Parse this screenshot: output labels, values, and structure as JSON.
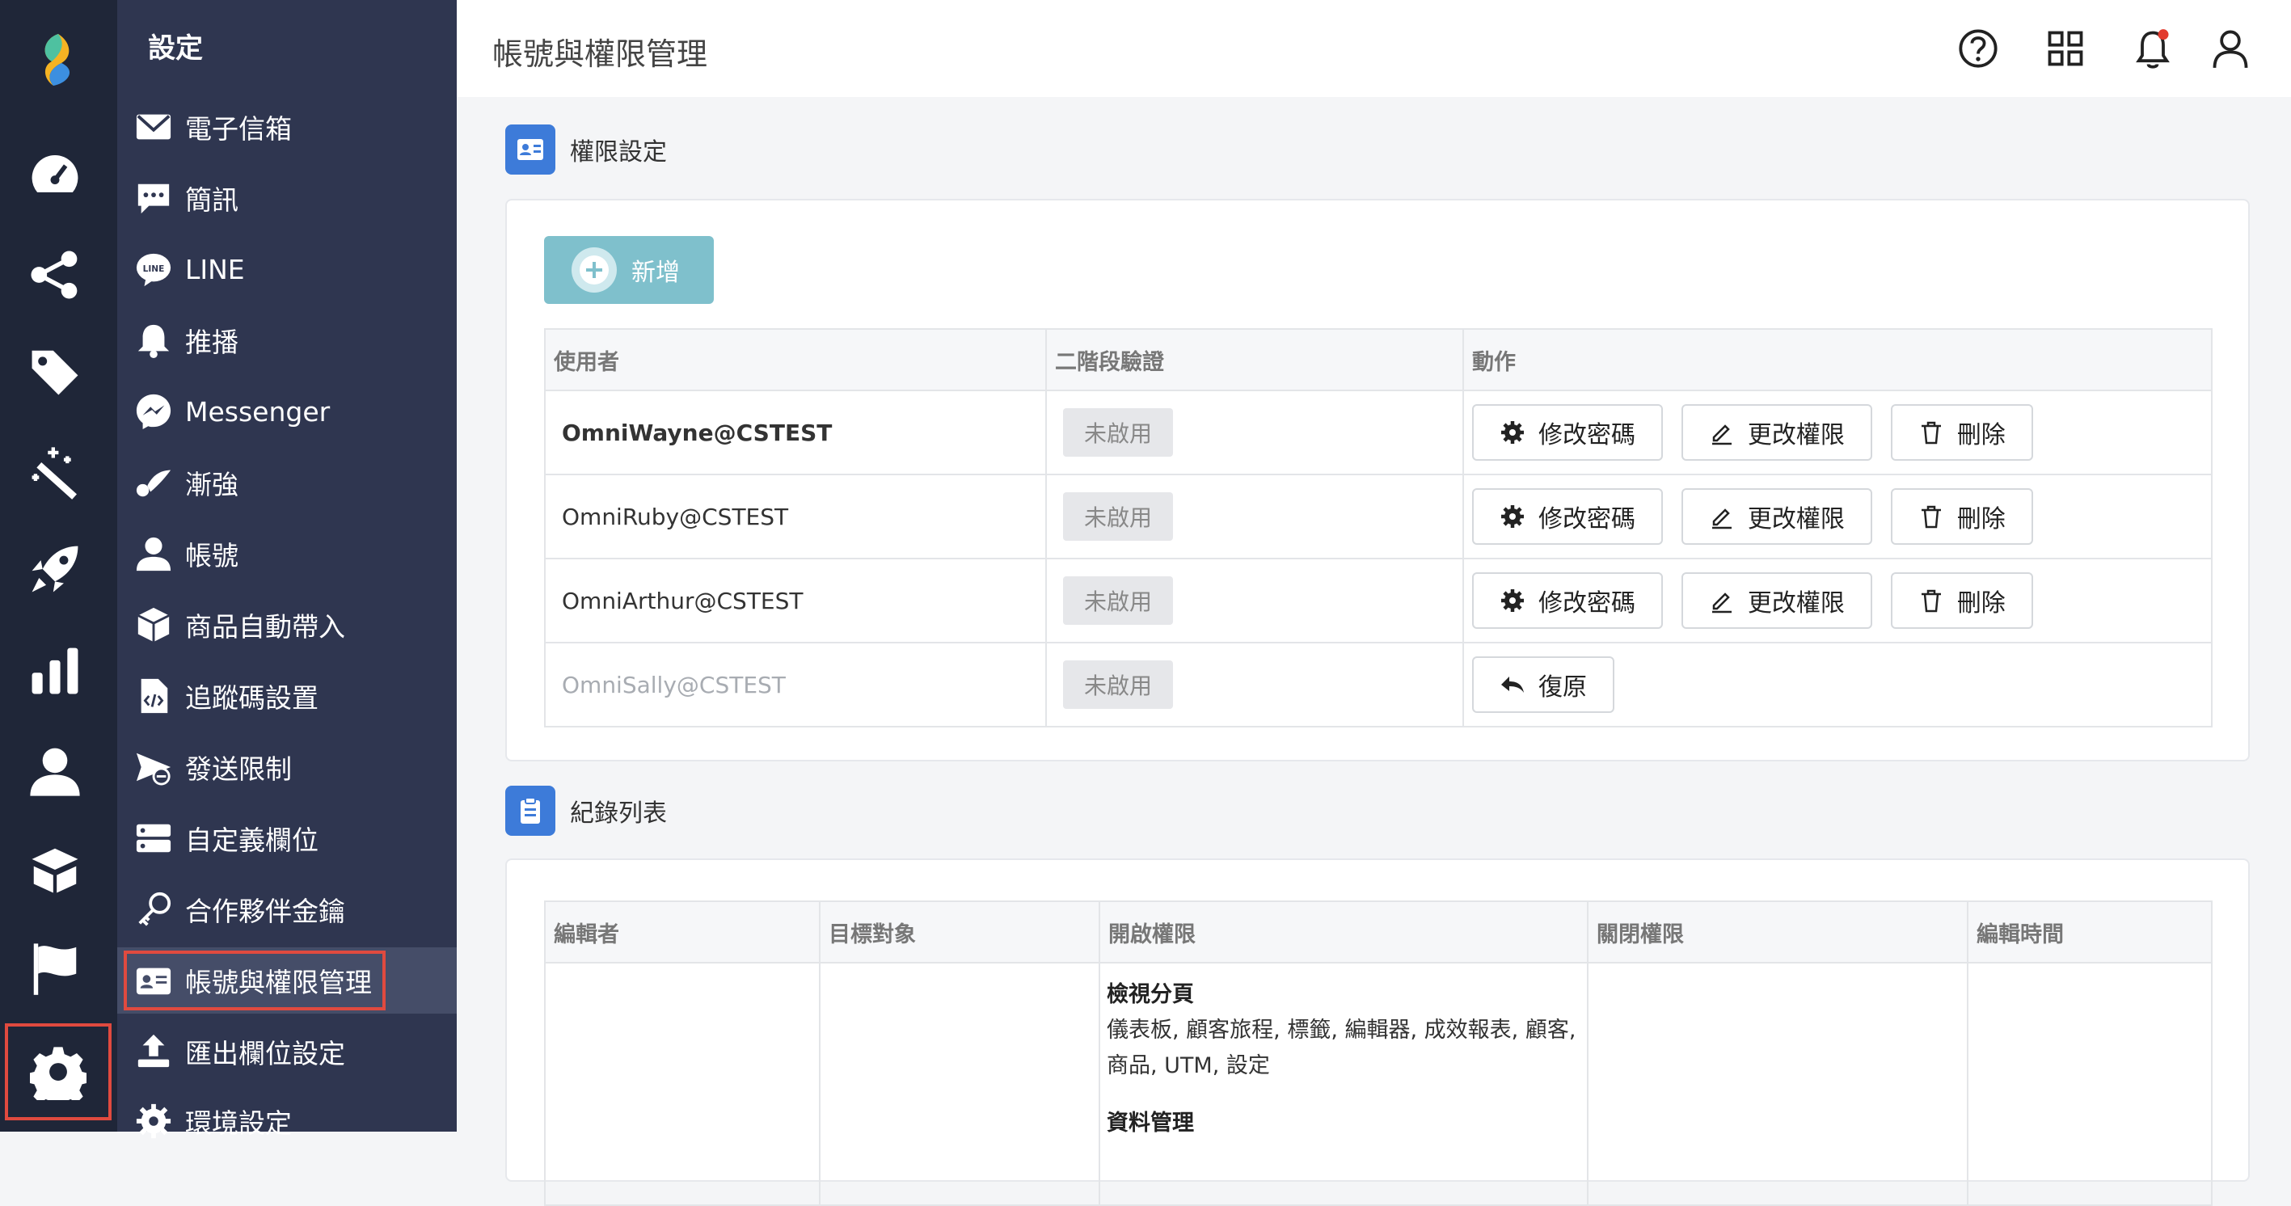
{
  "app": {
    "page_title": "帳號與權限管理"
  },
  "rail": {
    "items": [
      {
        "name": "dashboard-icon"
      },
      {
        "name": "journey-icon"
      },
      {
        "name": "tag-icon"
      },
      {
        "name": "magic-wand-icon"
      },
      {
        "name": "rocket-icon"
      },
      {
        "name": "report-icon"
      },
      {
        "name": "customer-icon"
      },
      {
        "name": "product-box-icon"
      },
      {
        "name": "flag-icon"
      },
      {
        "name": "settings-gear-icon"
      }
    ]
  },
  "sidebar": {
    "title": "設定",
    "items": [
      {
        "label": "電子信箱",
        "icon": "envelope-icon"
      },
      {
        "label": "簡訊",
        "icon": "sms-bubble-icon"
      },
      {
        "label": "LINE",
        "icon": "line-icon"
      },
      {
        "label": "推播",
        "icon": "bell-icon"
      },
      {
        "label": "Messenger",
        "icon": "messenger-icon"
      },
      {
        "label": "漸強",
        "icon": "crescendo-icon"
      },
      {
        "label": "帳號",
        "icon": "user-icon"
      },
      {
        "label": "商品自動帶入",
        "icon": "product-box-icon"
      },
      {
        "label": "追蹤碼設置",
        "icon": "code-file-icon"
      },
      {
        "label": "發送限制",
        "icon": "send-limit-icon"
      },
      {
        "label": "自定義欄位",
        "icon": "server-icon"
      },
      {
        "label": "合作夥伴金鑰",
        "icon": "key-icon"
      },
      {
        "label": "帳號與權限管理",
        "icon": "id-card-icon"
      },
      {
        "label": "匯出欄位設定",
        "icon": "upload-icon"
      },
      {
        "label": "環境設定",
        "icon": "gear-icon"
      }
    ]
  },
  "topbar": {
    "icons": [
      "help-icon",
      "apps-grid-icon",
      "notification-bell-icon",
      "user-profile-icon"
    ]
  },
  "permissions": {
    "section_title": "權限設定",
    "add_label": "新增",
    "columns": [
      "使用者",
      "二階段驗證",
      "動作"
    ],
    "rows": [
      {
        "user": "OmniWayne@CSTEST",
        "twofa": "未啟用",
        "actions": [
          "修改密碼",
          "更改權限",
          "刪除"
        ]
      },
      {
        "user": "OmniRuby@CSTEST",
        "twofa": "未啟用",
        "actions": [
          "修改密碼",
          "更改權限",
          "刪除"
        ]
      },
      {
        "user": "OmniArthur@CSTEST",
        "twofa": "未啟用",
        "actions": [
          "修改密碼",
          "更改權限",
          "刪除"
        ]
      },
      {
        "user": "OmniSally@CSTEST",
        "twofa": "未啟用",
        "actions": [
          "復原"
        ]
      }
    ]
  },
  "log": {
    "section_title": "紀錄列表",
    "columns": [
      "編輯者",
      "目標對象",
      "開啟權限",
      "關閉權限",
      "編輯時間"
    ],
    "rows": [
      {
        "editor": "",
        "target": "",
        "enabled_groups": [
          {
            "title": "檢視分頁",
            "text": "儀表板, 顧客旅程, 標籤, 編輯器, 成效報表, 顧客, 商品, UTM, 設定"
          },
          {
            "title": "資料管理",
            "text": ""
          }
        ],
        "disabled": "",
        "time": ""
      }
    ]
  },
  "colors": {
    "rail_bg": "#1f2638",
    "sidebar_bg": "#2f3650",
    "accent_blue": "#3d7bd9",
    "add_button": "#7fc0cc",
    "highlight_red": "#e04a3f"
  }
}
